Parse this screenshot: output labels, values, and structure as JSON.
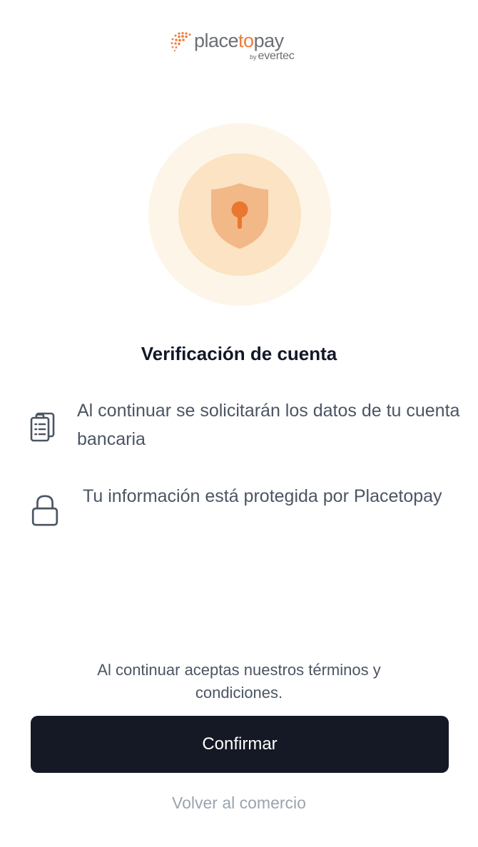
{
  "brand": {
    "name_prefix": "place",
    "name_accent": "to",
    "name_suffix": "pay",
    "by": "by",
    "parent": "evertec",
    "colors": {
      "accent": "#ee7c3a",
      "wordmark": "#6b6e73"
    }
  },
  "hero": {
    "icon": "shield-keyhole-icon",
    "colors": {
      "outer_ring": "#fdf5e8",
      "inner_ring": "#fbe3c3",
      "shield": "#f2b888",
      "keyhole": "#e9772f"
    }
  },
  "title": "Verificación de cuenta",
  "info": [
    {
      "icon": "clipboard-list-icon",
      "text": "Al continuar se solicitarán los datos de tu cuenta bancaria"
    },
    {
      "icon": "lock-icon",
      "text": "Tu información está protegida por Placetopay"
    }
  ],
  "terms": "Al continuar aceptas nuestros términos y condiciones.",
  "actions": {
    "confirm_label": "Confirmar",
    "back_label": "Volver al comercio"
  },
  "colors": {
    "primary_button": "#141925",
    "text_muted": "#4b5563",
    "link_muted": "#9ca3af"
  }
}
